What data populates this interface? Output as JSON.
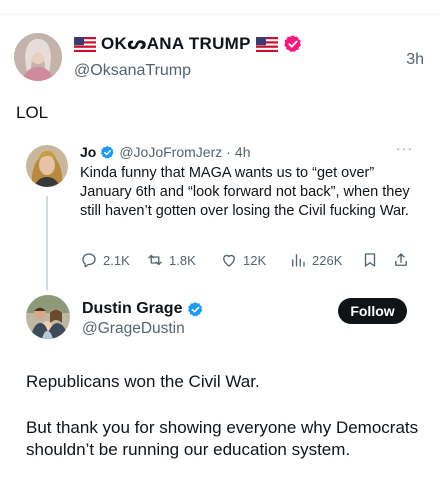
{
  "main_tweet": {
    "display_name": "OKᔕANA TRUMP",
    "handle": "@OksanaTrump",
    "time": "3h",
    "text": "LOL"
  },
  "quoted_tweet": {
    "display_name": "Jo",
    "handle": "@JoJoFromJerz",
    "separator": "·",
    "time": "4h",
    "text": "Kinda funny that MAGA wants us to “get over” January 6th and “look forward not back”, when they still haven’t gotten over losing the Civil fucking War.",
    "more_label": "···",
    "stats": {
      "replies": "2.1K",
      "reposts": "1.8K",
      "likes": "12K",
      "views": "226K"
    }
  },
  "reply_tweet": {
    "display_name": "Dustin Grage",
    "handle": "@GrageDustin",
    "follow_label": "Follow",
    "paragraph_1": "Republicans won the Civil War.",
    "paragraph_2": "But thank you for showing everyone why Democrats shouldn’t be running our education system."
  },
  "icons": {
    "verified": "verified-badge-icon",
    "flag": "us-flag-icon",
    "reply": "reply-icon",
    "repost": "repost-icon",
    "like": "heart-icon",
    "views": "views-icon",
    "bookmark": "bookmark-icon",
    "share": "share-icon"
  },
  "colors": {
    "verified_blue": "#1d9bf0",
    "text_secondary": "#536471",
    "follow_bg": "#0f1419"
  }
}
